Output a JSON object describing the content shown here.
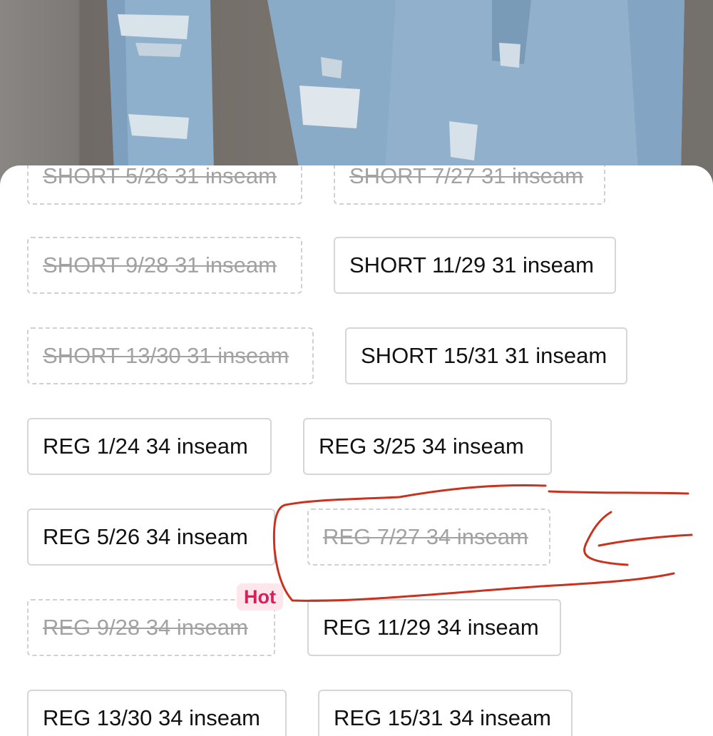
{
  "product_image": {
    "description_icon": "jeans-photo"
  },
  "sheet": {
    "size_options": [
      {
        "label": "SHORT 5/26 31 inseam",
        "state": "sold-out"
      },
      {
        "label": "SHORT 7/27 31 inseam",
        "state": "sold-out"
      },
      {
        "label": "SHORT 9/28 31 inseam",
        "state": "sold-out"
      },
      {
        "label": "SHORT 11/29 31 inseam",
        "state": "available"
      },
      {
        "label": "SHORT 13/30 31 inseam",
        "state": "sold-out"
      },
      {
        "label": "SHORT 15/31 31 inseam",
        "state": "available"
      },
      {
        "label": "REG 1/24 34 inseam",
        "state": "available"
      },
      {
        "label": "REG 3/25 34 inseam",
        "state": "available"
      },
      {
        "label": "REG 5/26 34 inseam",
        "state": "available"
      },
      {
        "label": "REG 7/27 34 inseam",
        "state": "sold-out"
      },
      {
        "label": "REG 9/28 34 inseam",
        "state": "sold-out"
      },
      {
        "label": "REG 11/29 34 inseam",
        "state": "available"
      },
      {
        "label": "REG 13/30 34 inseam",
        "state": "available"
      },
      {
        "label": "REG 15/31 34 inseam",
        "state": "available"
      }
    ],
    "hot_badge": "Hot"
  },
  "colors": {
    "annotation_stroke": "#c8321e",
    "hot_text": "#d81e5b",
    "hot_bg": "#fde6ec"
  }
}
